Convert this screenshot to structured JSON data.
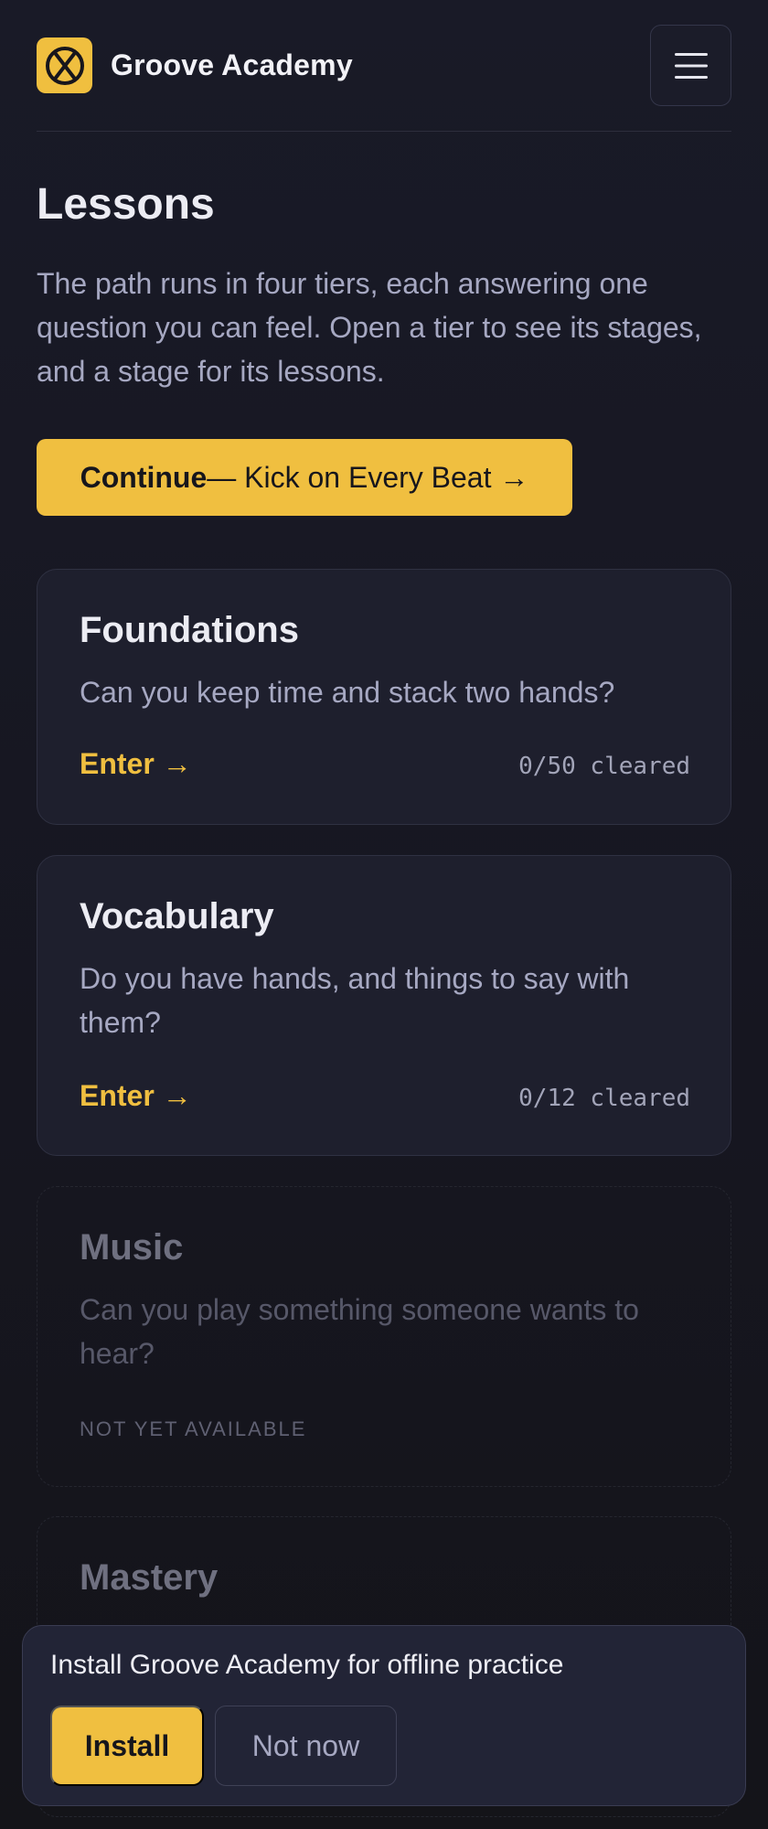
{
  "header": {
    "brand_name": "Groove Academy",
    "logo_icon": "drum-logo-icon",
    "menu_icon": "hamburger-menu-icon"
  },
  "main": {
    "title": "Lessons",
    "intro": "The path runs in four tiers, each answering one question you can feel. Open a tier to see its stages, and a stage for its lessons.",
    "continue_button": {
      "label_bold": "Continue",
      "label_rest": "— Kick on Every Beat →"
    }
  },
  "tiers": [
    {
      "title": "Foundations",
      "question": "Can you keep time and stack two hands?",
      "enter_label": "Enter →",
      "progress": "0/50 cleared",
      "available": true
    },
    {
      "title": "Vocabulary",
      "question": "Do you have hands, and things to say with them?",
      "enter_label": "Enter →",
      "progress": "0/12 cleared",
      "available": true
    },
    {
      "title": "Music",
      "question": "Can you play something someone wants to hear?",
      "status": "NOT YET AVAILABLE",
      "available": false
    },
    {
      "title": "Mastery",
      "available": false
    }
  ],
  "install_prompt": {
    "message": "Install Groove Academy for offline practice",
    "install_label": "Install",
    "dismiss_label": "Not now"
  },
  "colors": {
    "accent": "#f0bf40",
    "background": "#171823",
    "card": "#1e1f2d",
    "muted_text": "#a6a8c2"
  }
}
